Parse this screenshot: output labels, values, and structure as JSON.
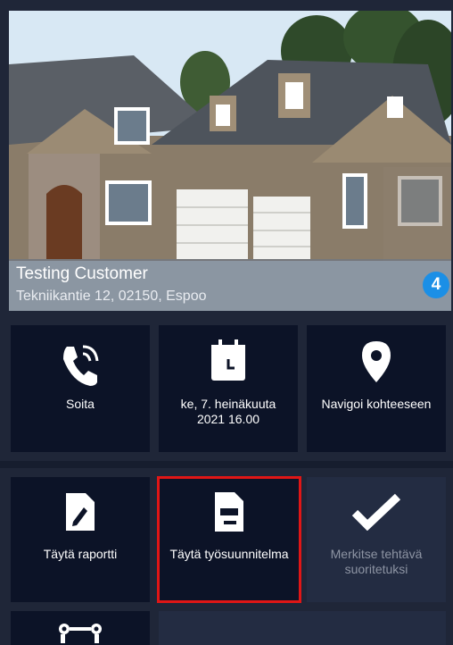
{
  "customer": {
    "name": "Testing Customer",
    "address": "Tekniikantie 12, 02150, Espoo",
    "badge_count": "4"
  },
  "actions_row1": [
    {
      "label": "Soita",
      "icon": "phone-icon"
    },
    {
      "label": "ke, 7. heinäkuuta 2021 16.00",
      "icon": "calendar-icon"
    },
    {
      "label": "Navigoi kohteeseen",
      "icon": "map-pin-icon"
    }
  ],
  "actions_row2": [
    {
      "label": "Täytä raportti",
      "icon": "report-icon"
    },
    {
      "label": "Täytä työsuunnitelma",
      "icon": "work-plan-icon"
    },
    {
      "label": "Merkitse tehtävä suoritetuksi",
      "icon": "checkmark-icon"
    }
  ],
  "actions_row3": [
    {
      "label": "",
      "icon": "route-icon"
    }
  ],
  "colors": {
    "tile": "#0c1327",
    "selection": "#e01616",
    "badge": "#1b8fe6"
  }
}
